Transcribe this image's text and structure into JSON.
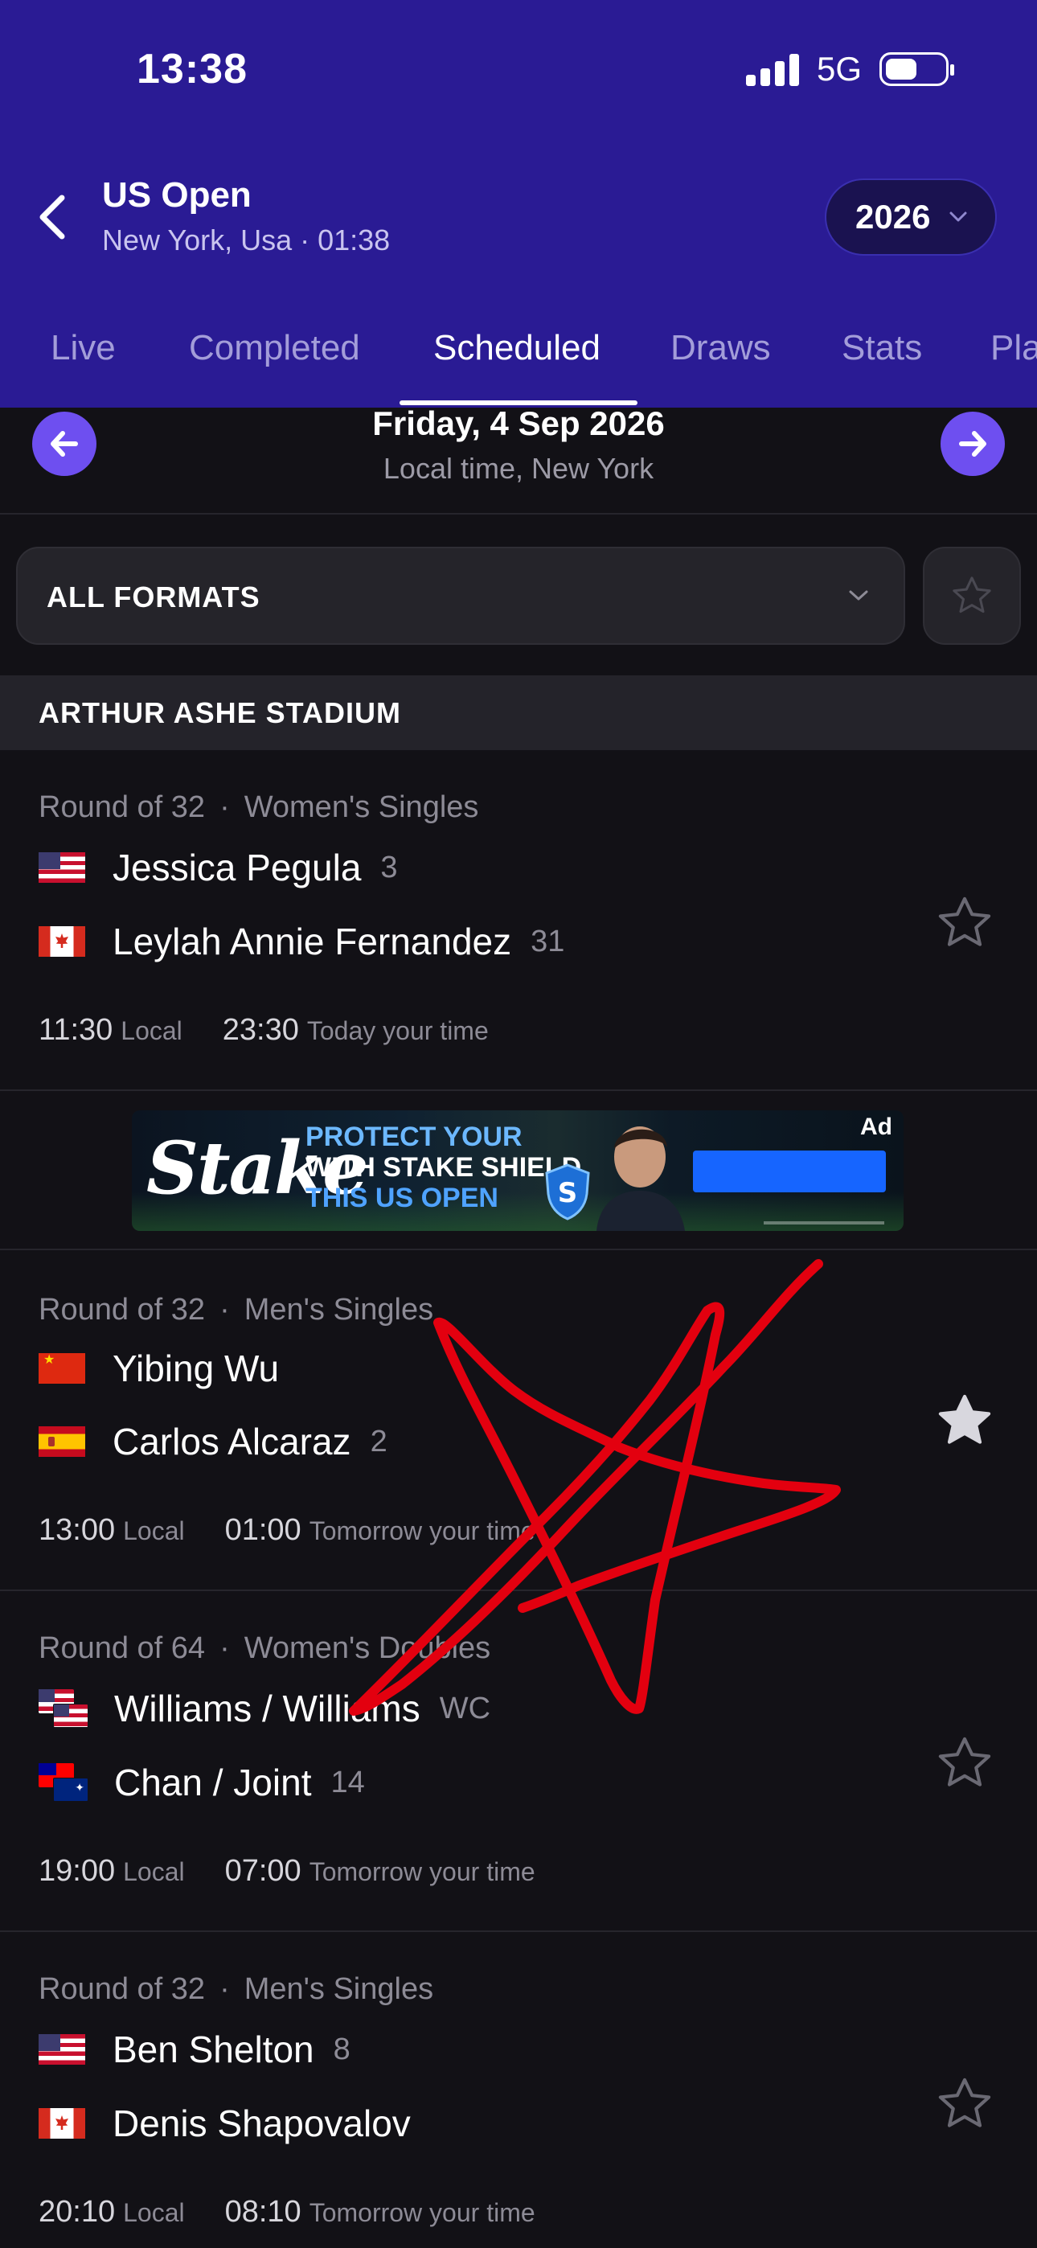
{
  "status_bar": {
    "time": "13:38",
    "network": "5G"
  },
  "header": {
    "title": "US Open",
    "subtitle": "New York, Usa · 01:38",
    "year": "2026",
    "tabs": [
      {
        "label": "Live"
      },
      {
        "label": "Completed"
      },
      {
        "label": "Scheduled",
        "active": true
      },
      {
        "label": "Draws"
      },
      {
        "label": "Stats"
      },
      {
        "label": "Pla"
      }
    ]
  },
  "date_nav": {
    "date": "Friday, 4 Sep 2026",
    "sub": "Local time, New York"
  },
  "filter": {
    "format_label": "ALL FORMATS"
  },
  "section": {
    "title": "ARTHUR ASHE STADIUM"
  },
  "matches": [
    {
      "round": "Round of 32",
      "category": "Women's Singles",
      "players": [
        {
          "name": "Jessica Pegula",
          "seed": "3",
          "flag": "us-flag"
        },
        {
          "name": "Leylah Annie Fernandez",
          "seed": "31",
          "flag": "ca-flag"
        }
      ],
      "local_time": "11:30",
      "local_label": "Local",
      "your_time": "23:30",
      "your_label": "Today your time",
      "favorited": false
    },
    {
      "round": "Round of 32",
      "category": "Men's Singles",
      "players": [
        {
          "name": "Yibing Wu",
          "seed": "",
          "flag": "cn-flag"
        },
        {
          "name": "Carlos Alcaraz",
          "seed": "2",
          "flag": "es-flag"
        }
      ],
      "local_time": "13:00",
      "local_label": "Local",
      "your_time": "01:00",
      "your_label": "Tomorrow your time",
      "favorited": true
    },
    {
      "round": "Round of 64",
      "category": "Women's Doubles",
      "players": [
        {
          "name": "Williams / Williams",
          "seed": "WC",
          "flag": "us-us-flag"
        },
        {
          "name": "Chan / Joint",
          "seed": "14",
          "flag": "tw-au-flag"
        }
      ],
      "local_time": "19:00",
      "local_label": "Local",
      "your_time": "07:00",
      "your_label": "Tomorrow your time",
      "favorited": false
    },
    {
      "round": "Round of 32",
      "category": "Men's Singles",
      "players": [
        {
          "name": "Ben Shelton",
          "seed": "8",
          "flag": "us-flag"
        },
        {
          "name": "Denis Shapovalov",
          "seed": "",
          "flag": "ca-flag"
        }
      ],
      "local_time": "20:10",
      "local_label": "Local",
      "your_time": "08:10",
      "your_label": "Tomorrow your time",
      "favorited": false
    }
  ],
  "ad": {
    "badge": "Ad",
    "brand": "Stake",
    "line1": "PROTECT YOUR",
    "line2": "WITH STAKE SHIELD",
    "line3": "THIS US OPEN"
  },
  "colors": {
    "header_bg": "#2a1b94",
    "accent": "#6e4ff0",
    "page_bg": "#121116",
    "scribble": "#e3000f"
  }
}
